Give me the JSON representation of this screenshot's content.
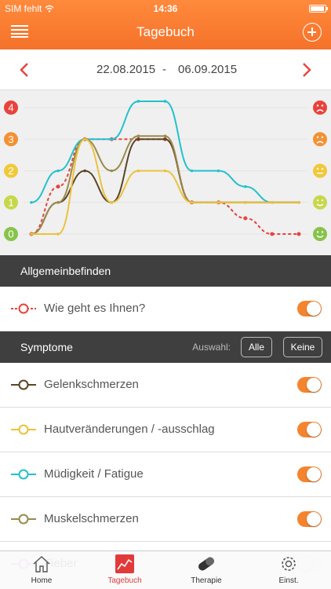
{
  "status": {
    "carrier": "SIM fehlt",
    "time": "14:36"
  },
  "header": {
    "title": "Tagebuch"
  },
  "date_range": {
    "start": "22.08.2015",
    "separator": "-",
    "end": "06.09.2015"
  },
  "chart_data": {
    "type": "line",
    "ylim": [
      0,
      4
    ],
    "y_ticks": [
      "0",
      "1",
      "2",
      "3",
      "4"
    ],
    "series": [
      {
        "color": "#e8433c",
        "dashed": true,
        "values": [
          0,
          1.5,
          3.0,
          3.0,
          3.0,
          3.0,
          1.0,
          1.0,
          0.5,
          0,
          0
        ]
      },
      {
        "color": "#22c1cf",
        "values": [
          1.0,
          2.0,
          3.0,
          3.0,
          4.2,
          4.2,
          2.0,
          2.0,
          1.5,
          1.0,
          1.0
        ]
      },
      {
        "color": "#5a4526",
        "values": [
          0,
          1.0,
          2.0,
          1.0,
          3.0,
          3.0,
          1.0,
          1.0,
          1.0,
          1.0,
          1.0
        ]
      },
      {
        "color": "#9a8a4c",
        "values": [
          0,
          1.0,
          3.0,
          2.0,
          3.1,
          3.1,
          1.0,
          1.0,
          1.0,
          1.0,
          1.0
        ]
      },
      {
        "color": "#ecc23c",
        "values": [
          0,
          0,
          3.0,
          1.0,
          2.0,
          2.0,
          1.0,
          1.0,
          1.0,
          1.0,
          1.0
        ]
      }
    ]
  },
  "sections": {
    "general": "Allgemeinbefinden",
    "symptoms": "Symptome",
    "auswahl": "Auswahl:",
    "all": "Alle",
    "none": "Keine"
  },
  "rows": [
    {
      "label": "Wie geht es Ihnen?",
      "color": "#e8433c",
      "dashed": true,
      "on": true
    },
    {
      "label": "Gelenkschmerzen",
      "color": "#5a4526",
      "dashed": false,
      "on": true
    },
    {
      "label": "Hautveränderungen / -ausschlag",
      "color": "#ecc23c",
      "dashed": false,
      "on": true
    },
    {
      "label": "Müdigkeit / Fatigue",
      "color": "#22c1cf",
      "dashed": false,
      "on": true
    },
    {
      "label": "Muskelschmerzen",
      "color": "#9a8a4c",
      "dashed": false,
      "on": true
    },
    {
      "label": "Fieber",
      "color": "#e070d0",
      "dashed": false,
      "on": false
    }
  ],
  "tabs": [
    {
      "label": "Home",
      "icon": "home-icon"
    },
    {
      "label": "Tagebuch",
      "icon": "chart-icon"
    },
    {
      "label": "Therapie",
      "icon": "pill-icon"
    },
    {
      "label": "Einst.",
      "icon": "gear-icon"
    }
  ]
}
